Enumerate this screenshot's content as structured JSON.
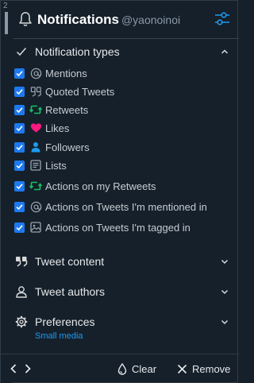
{
  "gutter": {
    "number": "2"
  },
  "header": {
    "title": "Notifications",
    "handle": "@yaonoinoi"
  },
  "sections": {
    "types": {
      "label": "Notification types",
      "expanded": true
    },
    "content": {
      "label": "Tweet content"
    },
    "authors": {
      "label": "Tweet authors"
    },
    "preferences": {
      "label": "Preferences",
      "sublabel": "Small media"
    }
  },
  "notification_types": [
    {
      "label": "Mentions",
      "checked": true,
      "icon": "at-icon"
    },
    {
      "label": "Quoted Tweets",
      "checked": true,
      "icon": "quote-icon"
    },
    {
      "label": "Retweets",
      "checked": true,
      "icon": "retweet-icon"
    },
    {
      "label": "Likes",
      "checked": true,
      "icon": "heart-icon"
    },
    {
      "label": "Followers",
      "checked": true,
      "icon": "person-icon"
    },
    {
      "label": "Lists",
      "checked": true,
      "icon": "list-icon"
    },
    {
      "label": "Actions on my Retweets",
      "checked": true,
      "icon": "retweet-icon"
    },
    {
      "label": "Actions on Tweets I'm mentioned in",
      "checked": true,
      "icon": "at-icon"
    },
    {
      "label": "Actions on Tweets I'm tagged in",
      "checked": true,
      "icon": "image-icon"
    }
  ],
  "footer": {
    "clear_label": "Clear",
    "remove_label": "Remove"
  },
  "colors": {
    "background": "#15202b",
    "accent": "#1d9bf0",
    "retweet": "#17bf63",
    "like": "#f91880",
    "checkbox": "#1d79ef"
  }
}
